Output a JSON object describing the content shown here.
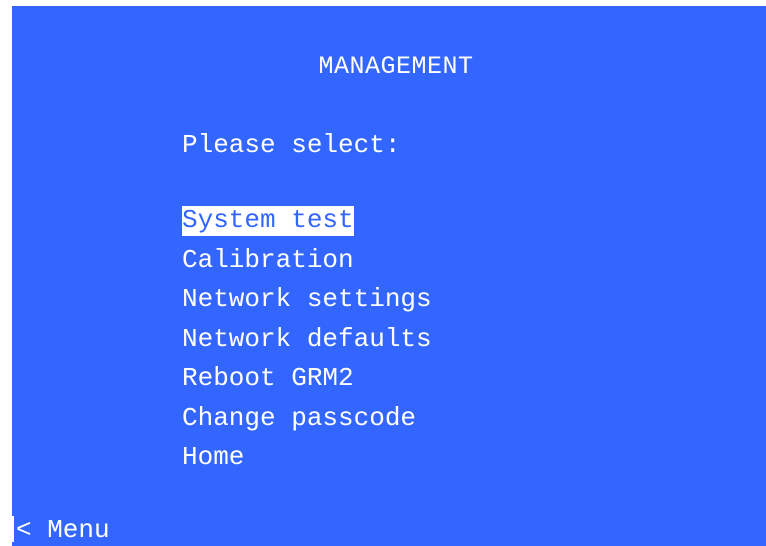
{
  "screen": {
    "title": "MANAGEMENT",
    "prompt": "Please select:",
    "menu": {
      "items": [
        {
          "label": "System test",
          "selected": true
        },
        {
          "label": "Calibration",
          "selected": false
        },
        {
          "label": "Network settings",
          "selected": false
        },
        {
          "label": "Network defaults",
          "selected": false
        },
        {
          "label": "Reboot GRM2",
          "selected": false
        },
        {
          "label": "Change passcode",
          "selected": false
        },
        {
          "label": "Home",
          "selected": false
        }
      ]
    },
    "back_label": "< Menu"
  },
  "colors": {
    "background": "#3366ff",
    "text": "#ffffff",
    "highlight_bg": "#ffffff",
    "highlight_text": "#3366ff"
  }
}
